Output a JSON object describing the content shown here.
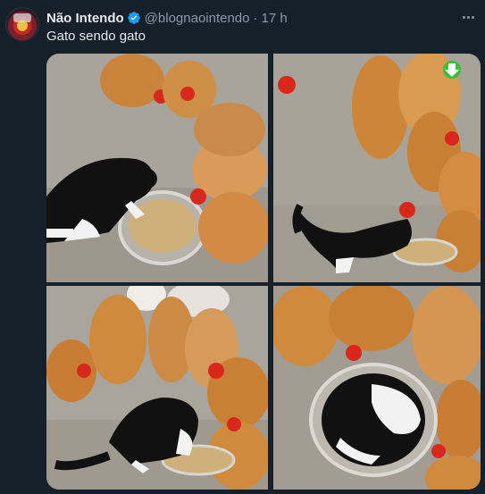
{
  "tweet": {
    "display_name": "Não Intendo",
    "handle": "@blognaointendo",
    "separator": "·",
    "time": "17 h",
    "text": "Gato sendo gato",
    "verified_color": "#1d9bf0"
  },
  "icons": {
    "verified": "verified-badge-icon",
    "more": "more-options-icon",
    "download": "download-arrow-icon"
  },
  "colors": {
    "background": "#15202b",
    "text": "#e7e9ea",
    "muted": "#8b98a5",
    "accent": "#1d9bf0",
    "download_badge": "#3bbf3b"
  }
}
